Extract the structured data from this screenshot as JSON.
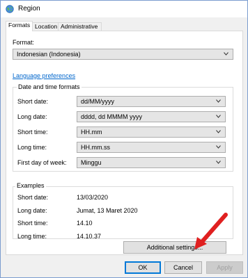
{
  "window": {
    "title": "Region",
    "icon": "globe-icon"
  },
  "tabs": [
    {
      "label": "Formats",
      "active": true
    },
    {
      "label": "Location",
      "active": false
    },
    {
      "label": "Administrative",
      "active": false
    }
  ],
  "format": {
    "label": "Format:",
    "value": "Indonesian (Indonesia)"
  },
  "language_link": "Language preferences",
  "date_time": {
    "title": "Date and time formats",
    "rows": [
      {
        "label": "Short date:",
        "value": "dd/MM/yyyy"
      },
      {
        "label": "Long date:",
        "value": "dddd, dd MMMM yyyy"
      },
      {
        "label": "Short time:",
        "value": "HH.mm"
      },
      {
        "label": "Long time:",
        "value": "HH.mm.ss"
      },
      {
        "label": "First day of week:",
        "value": "Minggu"
      }
    ]
  },
  "examples": {
    "title": "Examples",
    "rows": [
      {
        "label": "Short date:",
        "value": "13/03/2020"
      },
      {
        "label": "Long date:",
        "value": "Jumat, 13 Maret 2020"
      },
      {
        "label": "Short time:",
        "value": "14.10"
      },
      {
        "label": "Long time:",
        "value": "14.10.37"
      }
    ]
  },
  "buttons": {
    "additional": "Additional settings...",
    "ok": "OK",
    "cancel": "Cancel",
    "apply": "Apply"
  },
  "colors": {
    "link": "#0066cc",
    "annotation_arrow": "#e02020",
    "focus": "#0078d7"
  }
}
